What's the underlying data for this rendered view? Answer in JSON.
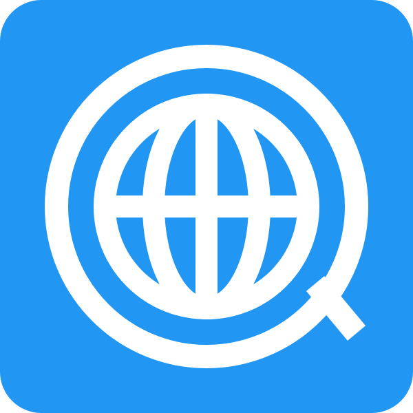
{
  "app_icon": {
    "icon_name": "globe-search-icon",
    "colors": {
      "background": "#2196F3",
      "foreground": "#FFFFFF"
    }
  }
}
